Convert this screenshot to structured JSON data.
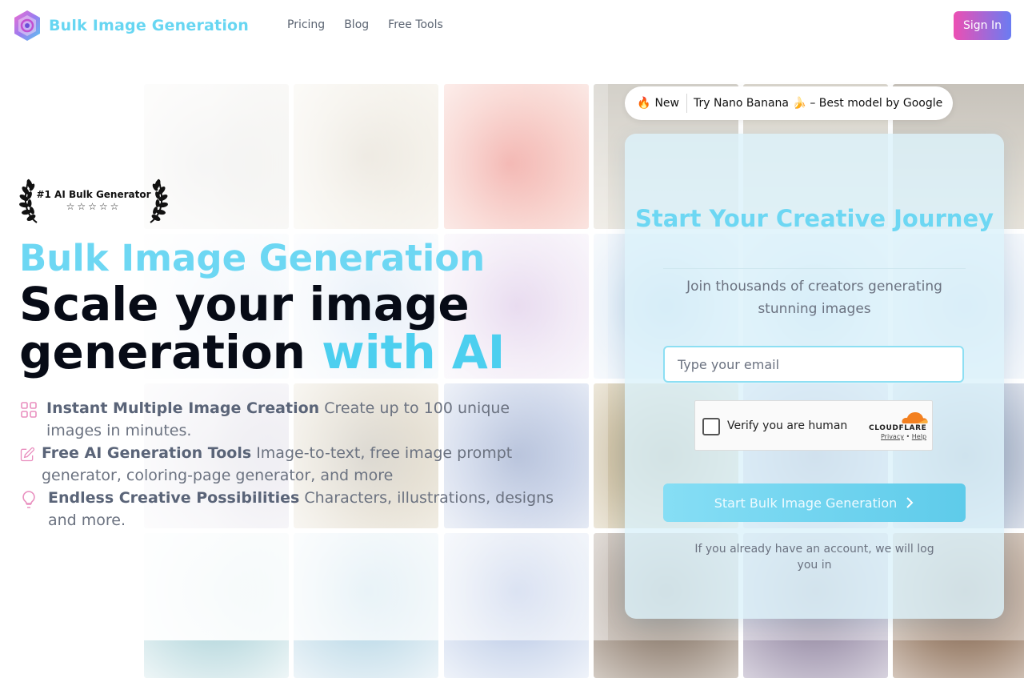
{
  "brand": {
    "name": "Bulk Image Generation",
    "logo_icon": "gem-logo-icon"
  },
  "nav": {
    "items": [
      "Pricing",
      "Blog",
      "Free Tools"
    ],
    "signin_label": "Sign In"
  },
  "hero": {
    "award": {
      "text": "#1 AI Bulk Generator",
      "stars": "☆☆☆☆☆"
    },
    "kicker": "Bulk Image Generation",
    "headline_line1": "Scale your image",
    "headline_line2_plain": "generation ",
    "headline_line2_accent": "with AI",
    "features": [
      {
        "icon": "grid-icon",
        "title": "Instant Multiple Image Creation",
        "text": " Create up to 100 unique images in minutes."
      },
      {
        "icon": "edit-icon",
        "title": "Free AI Generation Tools",
        "text": " Image-to-text, free image prompt generator, coloring-page generator, and more"
      },
      {
        "icon": "lightbulb-icon",
        "title": "Endless Creative Possibilities",
        "text": " Characters, illustrations, designs and more."
      }
    ]
  },
  "announcement": {
    "badge_emoji": "🔥",
    "badge_label": "New",
    "message": "Try Nano Banana 🍌 – Best model by Google"
  },
  "signup": {
    "title": "Start Your Creative Journey",
    "subtitle": "Join thousands of creators generating stunning images",
    "email_placeholder": "Type your email",
    "captcha": {
      "label": "Verify you are human",
      "brand": "CLOUDFLARE",
      "privacy": "Privacy",
      "sep": " • ",
      "help": "Help"
    },
    "cta_label": "Start Bulk Image Generation",
    "note": "If you already have an account, we will log you in"
  },
  "colors": {
    "accent": "#67d6f2",
    "heading": "#070b16",
    "signin_from": "#ec4fb3",
    "signin_to": "#6a7cf2"
  }
}
